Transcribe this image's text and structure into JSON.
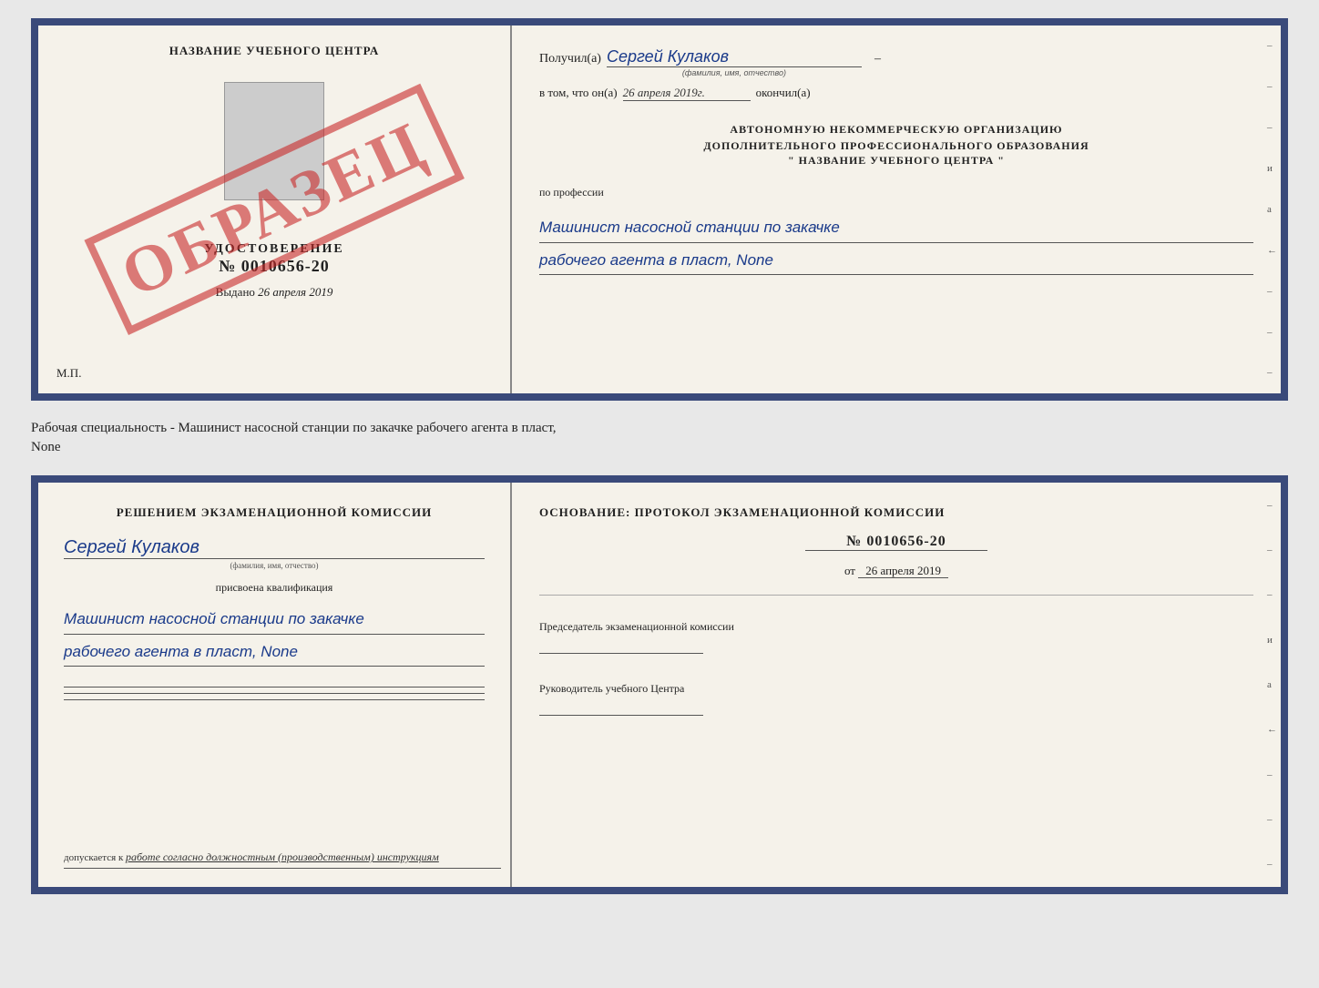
{
  "top_doc": {
    "left": {
      "title": "НАЗВАНИЕ УЧЕБНОГО ЦЕНТРА",
      "obrazec": "ОБРАЗЕЦ",
      "udostoverenie_label": "УДОСТОВЕРЕНИЕ",
      "number": "№ 0010656-20",
      "vydano_label": "Выдано",
      "vydano_date": "26 апреля 2019",
      "mp_label": "М.П."
    },
    "right": {
      "poluchil_label": "Получил(а)",
      "poluchil_name": "Сергей Кулаков",
      "poluchil_hint": "(фамилия, имя, отчество)",
      "v_tom_label": "в том, что он(а)",
      "v_tom_date": "26 апреля 2019г.",
      "okonchil_label": "окончил(а)",
      "org_line1": "АВТОНОМНУЮ НЕКОММЕРЧЕСКУЮ ОРГАНИЗАЦИЮ",
      "org_line2": "ДОПОЛНИТЕЛЬНОГО ПРОФЕССИОНАЛЬНОГО ОБРАЗОВАНИЯ",
      "org_quote": "\"  НАЗВАНИЕ УЧЕБНОГО ЦЕНТРА  \"",
      "po_professii_label": "по профессии",
      "profession_line1": "Машинист насосной станции по закачке",
      "profession_line2": "рабочего агента в пласт, None",
      "side_marks": [
        "-",
        "-",
        "-",
        "и",
        "а",
        "←",
        "-",
        "-",
        "-"
      ]
    }
  },
  "description": {
    "text": "Рабочая специальность - Машинист насосной станции по закачке рабочего агента в пласт,",
    "text2": "None"
  },
  "bottom_doc": {
    "left": {
      "resheniem_text": "Решением экзаменационной комиссии",
      "name": "Сергей Кулаков",
      "name_hint": "(фамилия, имя, отчество)",
      "prisvoyena_label": "присвоена квалификация",
      "kval_line1": "Машинист насосной станции по закачке",
      "kval_line2": "рабочего агента в пласт, None",
      "dopuskaetsya_label": "допускается к",
      "dopuskaetsya_text": "работе согласно должностным (производственным) инструкциям"
    },
    "right": {
      "osnovanie_label": "Основание: протокол экзаменационной комиссии",
      "protocol_number": "№ 0010656-20",
      "ot_label": "от",
      "ot_date": "26 апреля 2019",
      "predsedatel_label": "Председатель экзаменационной комиссии",
      "rukovoditel_label": "Руководитель учебного Центра",
      "side_marks": [
        "-",
        "-",
        "-",
        "и",
        "а",
        "←",
        "-",
        "-",
        "-"
      ]
    }
  }
}
